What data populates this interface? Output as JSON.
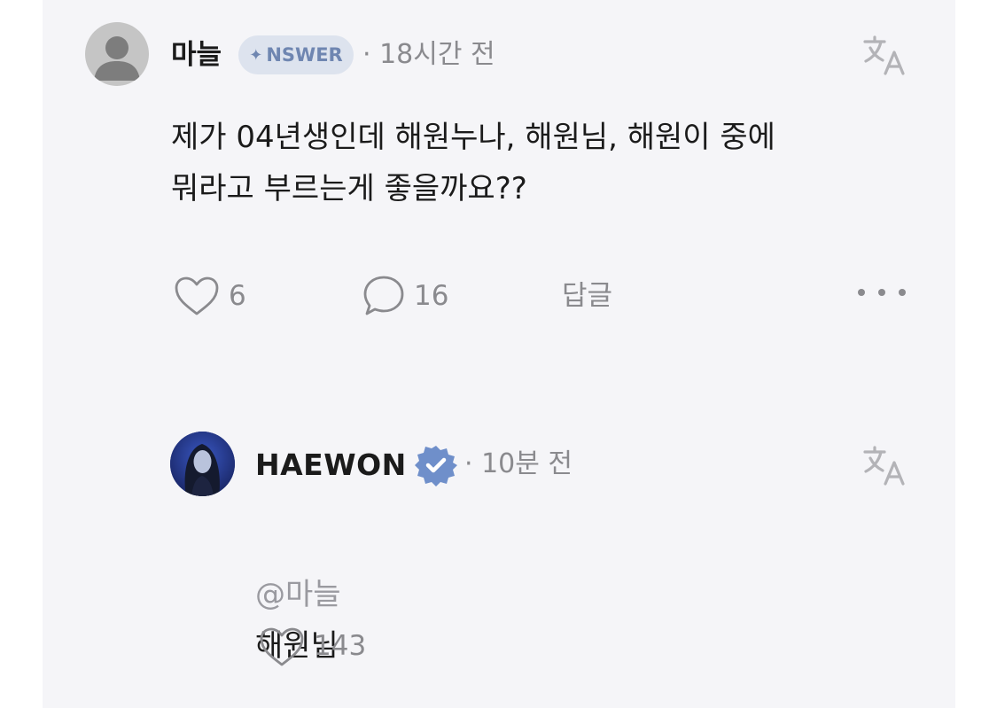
{
  "comment": {
    "author": "마늘",
    "badge": "NSWER",
    "badge_symbol": "✦",
    "timestamp": "· 18시간 전",
    "text": "제가 04년생인데 해원누나, 해원님, 해원이 중에\n뭐라고 부르는게 좋을까요??",
    "likes": "6",
    "replies": "16",
    "reply_label": "답글"
  },
  "reply": {
    "author": "HAEWON",
    "verified": true,
    "timestamp": "· 10분 전",
    "mention": "@마늘",
    "text": "해원님",
    "likes": "143"
  },
  "colors": {
    "card_bg": "#f5f5f8",
    "badge_bg": "#dde3ee",
    "badge_text": "#6f86b1",
    "verified_badge": "#6f8fca",
    "muted_text": "#8a8a8e"
  },
  "icons": [
    "user-avatar-icon",
    "translate-icon",
    "heart-icon",
    "comment-bubble-icon",
    "more-icon",
    "verified-badge-icon"
  ]
}
